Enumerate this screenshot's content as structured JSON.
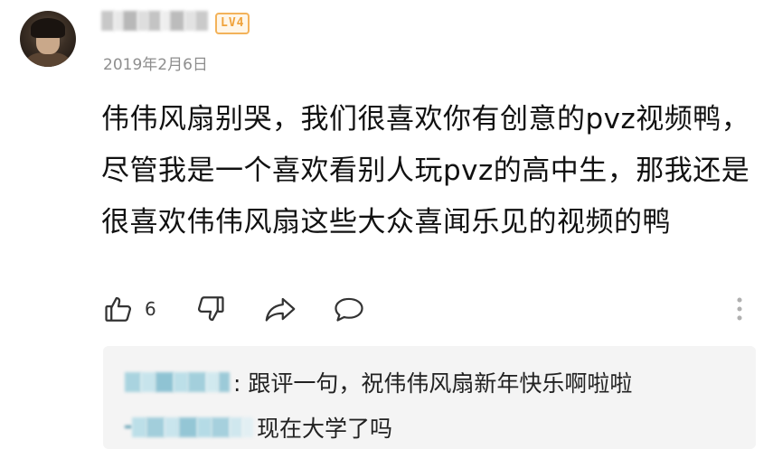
{
  "comment": {
    "level_badge": "LV4",
    "date": "2019年2月6日",
    "content": "伟伟风扇别哭，我们很喜欢你有创意的pvz视频鸭，尽管我是一个喜欢看别人玩pvz的高中生，那我还是很喜欢伟伟风扇这些大众喜闻乐见的视频的鸭",
    "like_count": "6"
  },
  "replies": [
    {
      "text": ": 跟评一句，祝伟伟风扇新年快乐啊啦啦"
    },
    {
      "text": "现在大学了吗"
    }
  ],
  "icons": {
    "like": "thumbs-up-icon",
    "dislike": "thumbs-down-icon",
    "share": "share-icon",
    "reply": "comment-bubble-icon",
    "more": "more-vertical-icon"
  },
  "colors": {
    "badge": "#f0a23a",
    "date": "#8e8e8e",
    "reply_bg": "#f4f4f4",
    "icon": "#333333"
  }
}
